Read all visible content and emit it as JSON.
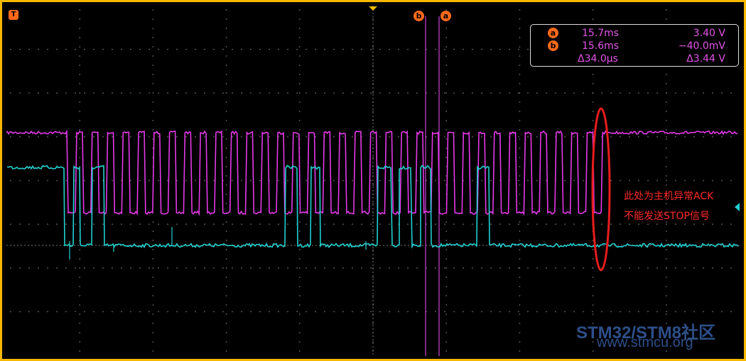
{
  "scope": {
    "trigger_marker": "T",
    "cursor_labels": [
      "b",
      "a"
    ],
    "colors": {
      "frame": "#f6b800",
      "channel_magenta": "#e43ae8",
      "channel_cyan": "#22d0d0",
      "cursor_line": "#b03ab8",
      "measurement_text": "#e454e8",
      "badge": "#ff6a1a",
      "annotation": "#ff2a2a",
      "ellipse": "#e81c1c",
      "watermark": "#2e4f89"
    }
  },
  "measurements": {
    "rows": [
      {
        "badge": "a",
        "time": "15.7ms",
        "voltage": "3.40 V"
      },
      {
        "badge": "b",
        "time": "15.6ms",
        "voltage": "−40.0mV"
      },
      {
        "badge": "",
        "time": "Δ34.0μs",
        "voltage": "Δ3.44 V"
      }
    ]
  },
  "annotation": {
    "line1": "此处为主机异常ACK",
    "line2": "不能发送STOP信号"
  },
  "watermark": {
    "line1": "STM32/STM8社区",
    "line2": "www.stmcu.org"
  }
}
